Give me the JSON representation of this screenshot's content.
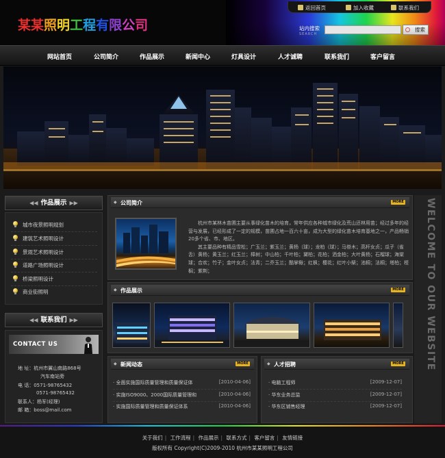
{
  "header": {
    "logo_text": "某某照明工程有限公司",
    "logo_colors": [
      "#e53030",
      "#e53030",
      "#f0a020",
      "#f0d020",
      "#40c040",
      "#20a0e0",
      "#2050e0",
      "#9040d0",
      "#d040c0",
      "#e03080"
    ],
    "top_links": [
      {
        "label": "返回首页",
        "icon": "home-icon"
      },
      {
        "label": "加入收藏",
        "icon": "favorite-icon"
      },
      {
        "label": "联系我们",
        "icon": "mail-icon"
      }
    ],
    "search": {
      "label": "站内搜索",
      "label_en": "SEARCH",
      "placeholder": "",
      "button": "搜索"
    }
  },
  "nav": {
    "items": [
      "网站首页",
      "公司简介",
      "作品展示",
      "新闻中心",
      "灯具设计",
      "人才诚聘",
      "联系我们",
      "客户留言"
    ]
  },
  "sidebar": {
    "products_title": "作品展示",
    "products": [
      "城市夜景照明规划",
      "建筑艺术照明设计",
      "景观艺术照明设计",
      "道路广场照明设计",
      "桥梁照明设计",
      "商业街照明"
    ],
    "contact_title": "联系我们",
    "contact_banner": "CONTACT US",
    "contact_lines": [
      "地  址：杭州市翼山南路868号",
      "汽车南站旁",
      "电  话：0571-98765432",
      "0571-98765432",
      "联系人：杨军(经理)",
      "邮  箱：boss@mail.com"
    ]
  },
  "about": {
    "title": "公司简介",
    "more": "MORE",
    "paragraphs": [
      "杭州市某林木苗圃主要从事绿化苗木的培育，常年供应各种城市绿化及荒山还林用苗；经过多年的经营与发展，已经形成了一定的规模，苗圃占地一百六十亩，成为大型的绿化苗木培育基地之一，产品畅销20多个省、市、地区。",
      "其主要品种有精品雪松；广玉兰；紫玉兰；黄杨（球）；龙柏（球）；马褂木；高杆女贞；瓜子（雀舌）黄杨；黄玉兰；红玉兰；樟树；中山柏；千叶柏；黛柏；花柏；洒金柏；大叶黄杨；石榴球；海棠球；合欢；竹子；金叶女贞；法青；二乔玉兰；酷掌楸；红枫；樱花；红叶小檗；池桐；法桐；塔柏；桎榈；紫荆；"
    ]
  },
  "projects": {
    "title": "作品展示",
    "more": "MORE"
  },
  "news": {
    "title": "新闻动态",
    "more": "MORE",
    "items": [
      {
        "title": "全面实施国际质量管理和质量保证体",
        "date": "[2010-04-06]"
      },
      {
        "title": "实施ISO9000、2000国际质量管理和",
        "date": "[2010-04-06]"
      },
      {
        "title": "实施国际质量管理和质量保证体系",
        "date": "[2010-04-06]"
      }
    ]
  },
  "jobs": {
    "title": "人才招聘",
    "more": "MORE",
    "items": [
      {
        "title": "电脑工程师",
        "date": "[2009-12-07]"
      },
      {
        "title": "华东业务总监",
        "date": "[2009-12-07]"
      },
      {
        "title": "华东区销售经理",
        "date": "[2009-12-07]"
      }
    ]
  },
  "welcome_text": "WELCOME TO OUR WEBSITE",
  "footer": {
    "links": [
      "关于我们",
      "工作流程",
      "作品展示",
      "联系方式",
      "客户留言",
      "友情链接"
    ],
    "copyright": "版权所有 Copyright(C)2009-2010 杭州市某某照明工程公司"
  }
}
